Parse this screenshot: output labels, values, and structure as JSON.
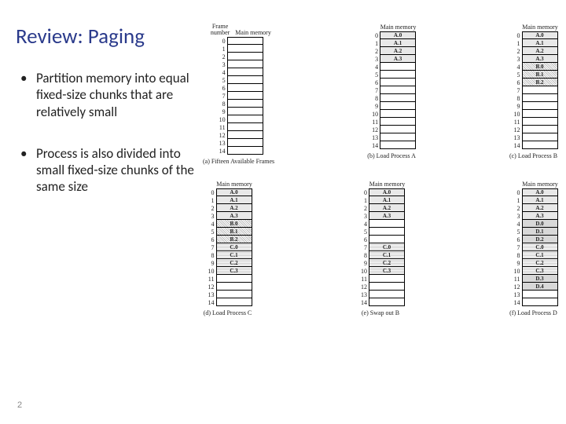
{
  "title": "Review: Paging",
  "bullets": [
    "Partition memory into equal fixed-size chunks that are relatively small",
    "Process is also divided into small fixed-size chunks of the same size"
  ],
  "page_number": "2",
  "header_frame_number": "Frame number",
  "header_main_memory": "Main memory",
  "frame_count": 15,
  "panels": [
    {
      "id": "a",
      "caption": "(a) Fifteen Available Frames",
      "show_frame_nums": true,
      "frames": [
        null,
        null,
        null,
        null,
        null,
        null,
        null,
        null,
        null,
        null,
        null,
        null,
        null,
        null,
        null
      ]
    },
    {
      "id": "b",
      "caption": "(b) Load Process A",
      "show_frame_nums": true,
      "frames": [
        {
          "t": "A.0",
          "c": "a"
        },
        {
          "t": "A.1",
          "c": "a"
        },
        {
          "t": "A.2",
          "c": "a"
        },
        {
          "t": "A.3",
          "c": "a"
        },
        null,
        null,
        null,
        null,
        null,
        null,
        null,
        null,
        null,
        null,
        null
      ]
    },
    {
      "id": "c",
      "caption": "(c) Load Process B",
      "show_frame_nums": true,
      "frames": [
        {
          "t": "A.0",
          "c": "a"
        },
        {
          "t": "A.1",
          "c": "a"
        },
        {
          "t": "A.2",
          "c": "a"
        },
        {
          "t": "A.3",
          "c": "a"
        },
        {
          "t": "B.0",
          "c": "b"
        },
        {
          "t": "B.1",
          "c": "b"
        },
        {
          "t": "B.2",
          "c": "b"
        },
        null,
        null,
        null,
        null,
        null,
        null,
        null,
        null
      ]
    },
    {
      "id": "d",
      "caption": "(d) Load Process C",
      "show_frame_nums": true,
      "frames": [
        {
          "t": "A.0",
          "c": "a"
        },
        {
          "t": "A.1",
          "c": "a"
        },
        {
          "t": "A.2",
          "c": "a"
        },
        {
          "t": "A.3",
          "c": "a"
        },
        {
          "t": "B.0",
          "c": "b"
        },
        {
          "t": "B.1",
          "c": "b"
        },
        {
          "t": "B.2",
          "c": "b"
        },
        {
          "t": "C.0",
          "c": "c"
        },
        {
          "t": "C.1",
          "c": "c"
        },
        {
          "t": "C.2",
          "c": "c"
        },
        {
          "t": "C.3",
          "c": "c"
        },
        null,
        null,
        null,
        null
      ]
    },
    {
      "id": "e",
      "caption": "(e) Swap out B",
      "show_frame_nums": true,
      "frames": [
        {
          "t": "A.0",
          "c": "a"
        },
        {
          "t": "A.1",
          "c": "a"
        },
        {
          "t": "A.2",
          "c": "a"
        },
        {
          "t": "A.3",
          "c": "a"
        },
        null,
        null,
        null,
        {
          "t": "C.0",
          "c": "c"
        },
        {
          "t": "C.1",
          "c": "c"
        },
        {
          "t": "C.2",
          "c": "c"
        },
        {
          "t": "C.3",
          "c": "c"
        },
        null,
        null,
        null,
        null
      ]
    },
    {
      "id": "f",
      "caption": "(f) Load Process D",
      "show_frame_nums": true,
      "frames": [
        {
          "t": "A.0",
          "c": "a"
        },
        {
          "t": "A.1",
          "c": "a"
        },
        {
          "t": "A.2",
          "c": "a"
        },
        {
          "t": "A.3",
          "c": "a"
        },
        {
          "t": "D.0",
          "c": "d"
        },
        {
          "t": "D.1",
          "c": "d"
        },
        {
          "t": "D.2",
          "c": "d"
        },
        {
          "t": "C.0",
          "c": "c"
        },
        {
          "t": "C.1",
          "c": "c"
        },
        {
          "t": "C.2",
          "c": "c"
        },
        {
          "t": "C.3",
          "c": "c"
        },
        {
          "t": "D.3",
          "c": "d"
        },
        {
          "t": "D.4",
          "c": "d"
        },
        null,
        null
      ]
    }
  ]
}
